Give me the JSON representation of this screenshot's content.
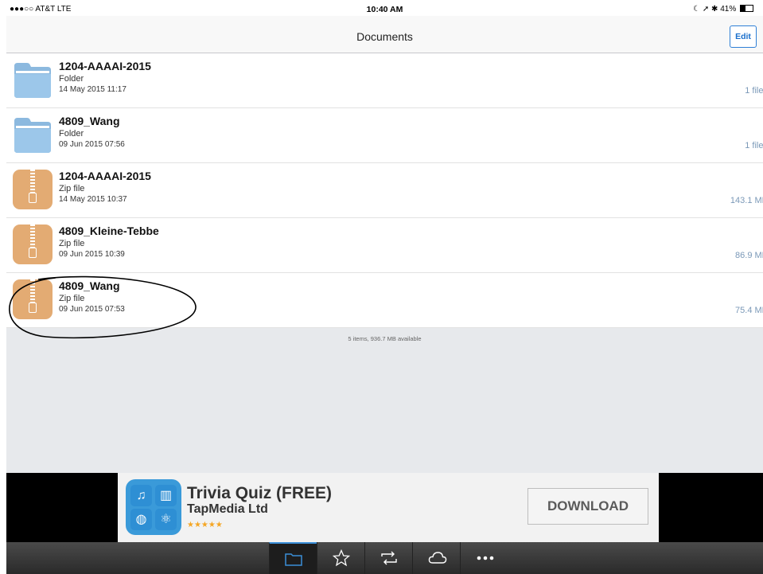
{
  "status_bar": {
    "carrier": "●●●○○ AT&T  LTE",
    "time": "10:40 AM",
    "indicators": "☾ ➚ ✱ 41%",
    "battery_percent": 41
  },
  "navbar": {
    "title": "Documents",
    "edit_label": "Edit"
  },
  "files": [
    {
      "name": "1204-AAAAI-2015",
      "type": "Folder",
      "date": "14 May 2015 11:17",
      "size": "1 files",
      "icon": "folder-icon"
    },
    {
      "name": "4809_Wang",
      "type": "Folder",
      "date": "09 Jun 2015 07:56",
      "size": "1 files",
      "icon": "folder-icon"
    },
    {
      "name": "1204-AAAAI-2015",
      "type": "Zip file",
      "date": "14 May 2015 10:37",
      "size": "143.1 MB",
      "icon": "zip-file-icon"
    },
    {
      "name": "4809_Kleine-Tebbe",
      "type": "Zip file",
      "date": "09 Jun 2015 10:39",
      "size": "86.9 MB",
      "icon": "zip-file-icon"
    },
    {
      "name": "4809_Wang",
      "type": "Zip file",
      "date": "09 Jun 2015 07:53",
      "size": "75.4 MB",
      "icon": "zip-file-icon"
    }
  ],
  "summary": "5 items, 936.7 MB available",
  "ad": {
    "title": "Trivia Quiz (FREE)",
    "publisher": "TapMedia Ltd",
    "stars": "★★★★★",
    "rating": 5,
    "button_label": "DOWNLOAD"
  },
  "tabbar": {
    "tabs": [
      "folder-icon",
      "star-icon",
      "transfer-icon",
      "cloud-icon",
      "more-icon"
    ],
    "active_index": 0
  },
  "colors": {
    "accent": "#1a6fcc",
    "folder": "#8cb9df",
    "zip": "#e3ab73",
    "size_text": "#7b99b8"
  }
}
